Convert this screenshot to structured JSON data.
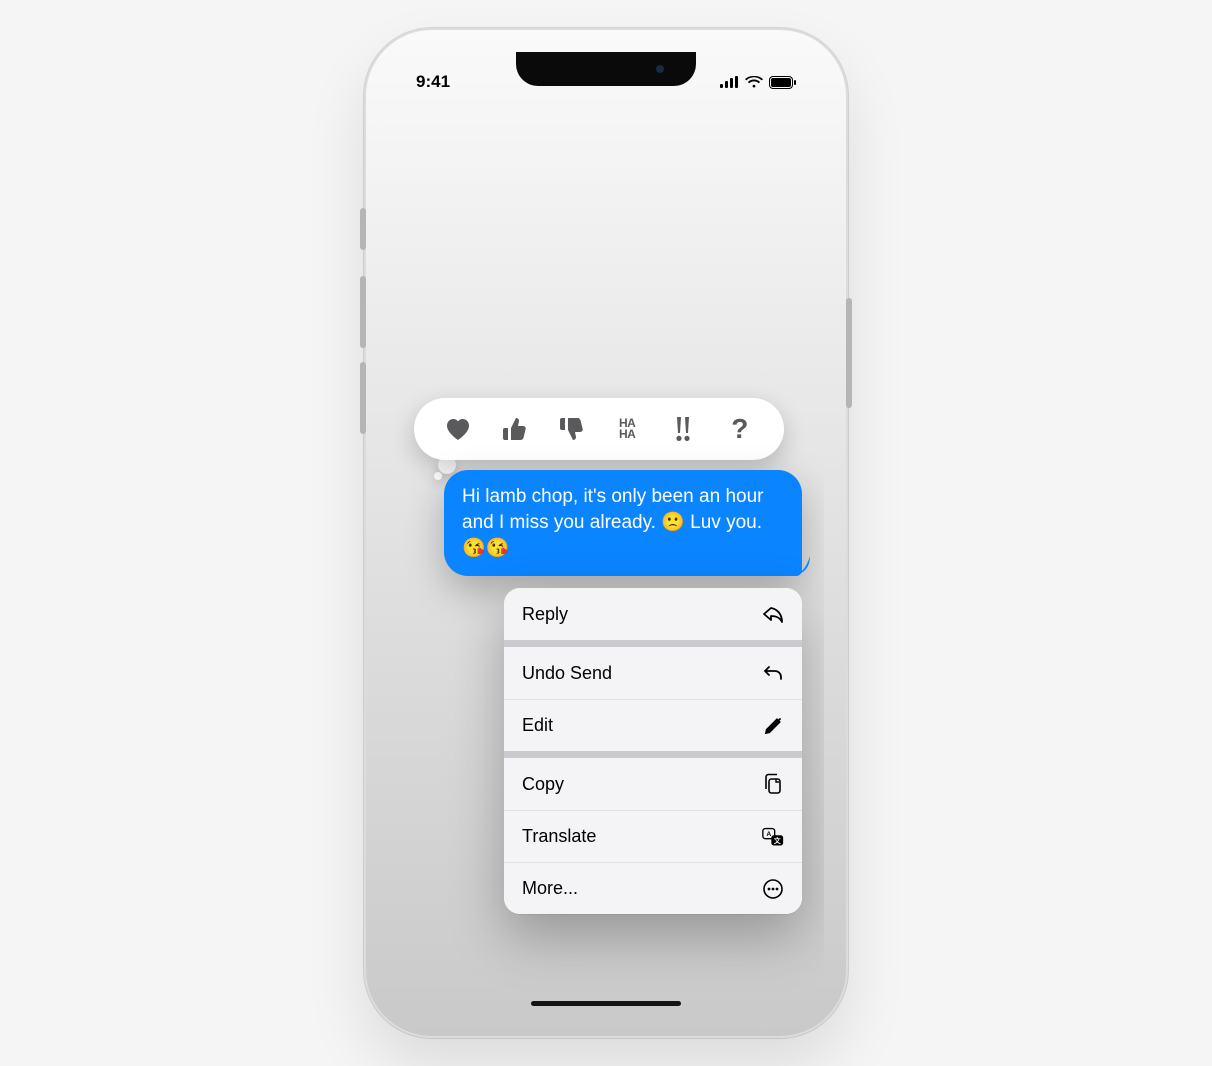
{
  "statusbar": {
    "time": "9:41"
  },
  "tapback": {
    "heart": "heart",
    "like": "thumbs-up",
    "dislike": "thumbs-down",
    "haha": "HAHA",
    "emphasis": "!!",
    "question": "?"
  },
  "message": {
    "text": "Hi lamb chop, it's only been an hour and I miss you already. 🙁 Luv you. 😘😘"
  },
  "menu": {
    "reply": "Reply",
    "undo": "Undo Send",
    "edit": "Edit",
    "copy": "Copy",
    "translate": "Translate",
    "more": "More..."
  }
}
